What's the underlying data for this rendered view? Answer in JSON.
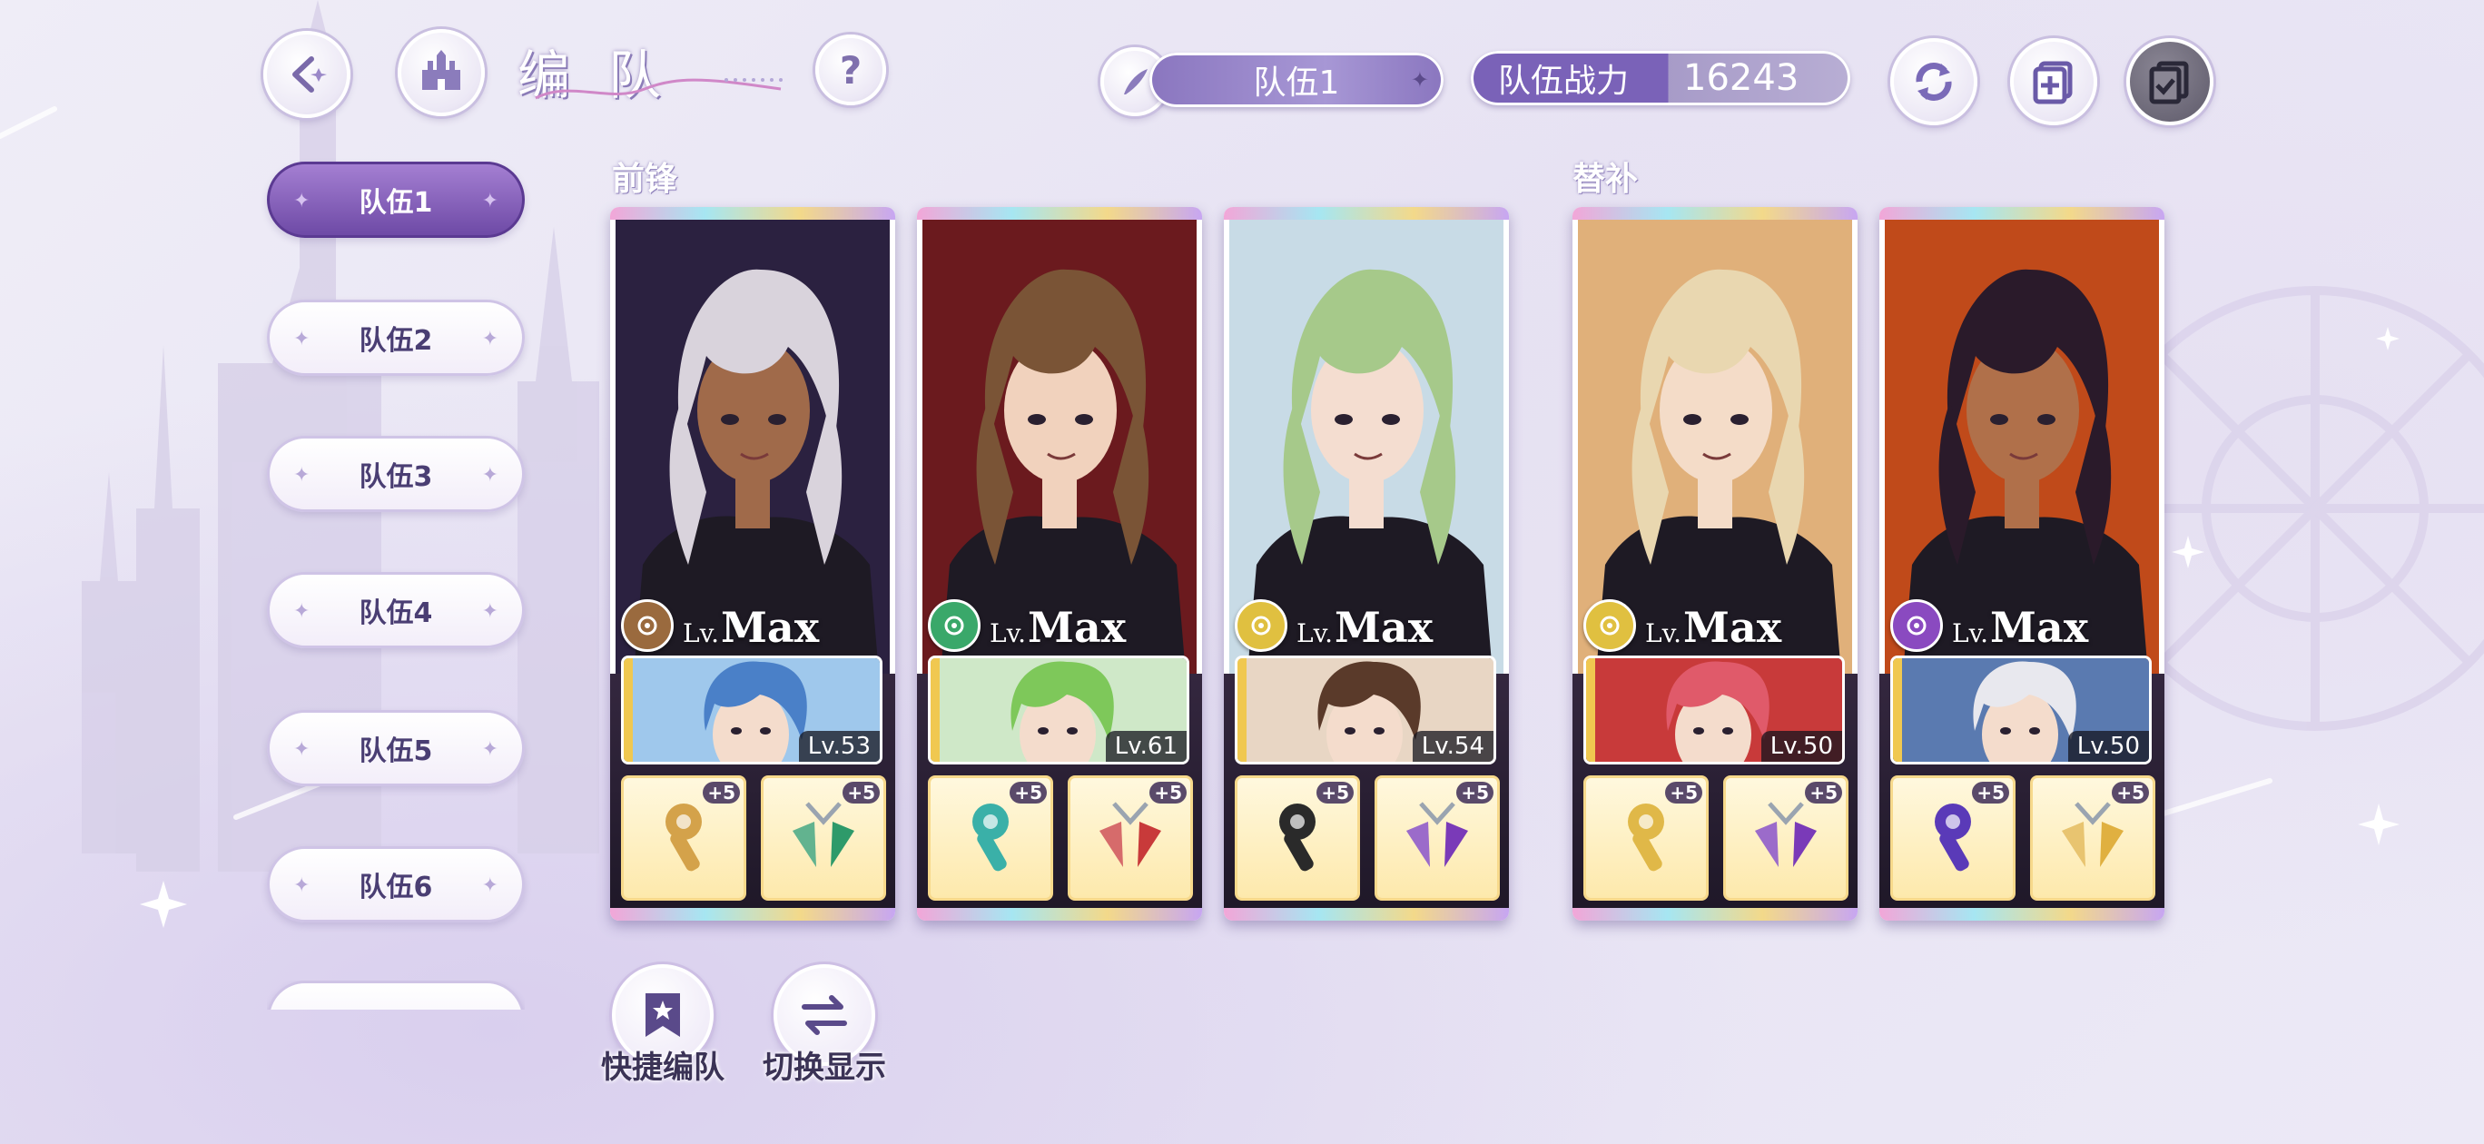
{
  "header": {
    "title_chars": [
      "编",
      "队"
    ],
    "team_select": {
      "label": "队伍1"
    },
    "power": {
      "label": "队伍战力",
      "value": "16243"
    }
  },
  "teams": [
    {
      "label": "队伍1",
      "active": true
    },
    {
      "label": "队伍2"
    },
    {
      "label": "队伍3"
    },
    {
      "label": "队伍4"
    },
    {
      "label": "队伍5"
    },
    {
      "label": "队伍6"
    }
  ],
  "sections": {
    "front": "前锋",
    "bench": "替补"
  },
  "cards": [
    {
      "lv_prefix": "Lv.",
      "lv_value": "Max",
      "attr_color": "#9a6a3e",
      "hair": "#d9d3dc",
      "skin": "#a06a4a",
      "bg": "#2b2140",
      "support_lv": "Lv.53",
      "support_hair": "#4a80c8",
      "support_bg": "#9fc8ec",
      "gear_colors": [
        "#d4a24a",
        "#2e9a6a"
      ]
    },
    {
      "lv_prefix": "Lv.",
      "lv_value": "Max",
      "attr_color": "#3aa86a",
      "hair": "#7a5436",
      "skin": "#f1d2bd",
      "bg": "#6b1a1e",
      "support_lv": "Lv.61",
      "support_hair": "#7ec85a",
      "support_bg": "#cfe8c8",
      "gear_colors": [
        "#3ab0a8",
        "#c83a3a"
      ]
    },
    {
      "lv_prefix": "Lv.",
      "lv_value": "Max",
      "attr_color": "#e0c040",
      "hair": "#a6c98a",
      "skin": "#f4ddd0",
      "bg": "#c8dbe6",
      "support_lv": "Lv.54",
      "support_hair": "#5a3a2a",
      "support_bg": "#e8d6c4",
      "gear_colors": [
        "#2a2a2a",
        "#7a3ab8"
      ]
    },
    {
      "lv_prefix": "Lv.",
      "lv_value": "Max",
      "attr_color": "#e0c040",
      "hair": "#e9d7b0",
      "skin": "#f4dcc8",
      "bg": "#e0b07a",
      "support_lv": "Lv.50",
      "support_hair": "#e05a6a",
      "support_bg": "#c83a3a",
      "gear_colors": [
        "#e0b848",
        "#7a3ab8"
      ]
    },
    {
      "lv_prefix": "Lv.",
      "lv_value": "Max",
      "attr_color": "#8a4ac0",
      "hair": "#2a1a2a",
      "skin": "#b0704a",
      "bg": "#c04a1a",
      "support_lv": "Lv.50",
      "support_hair": "#e8e8ee",
      "support_bg": "#5a7ab0",
      "gear_colors": [
        "#5a3ab8",
        "#e0b040"
      ]
    }
  ],
  "gear_plus": "+5",
  "actions": {
    "quick_label": "快捷编队",
    "switch_label": "切换显示"
  }
}
